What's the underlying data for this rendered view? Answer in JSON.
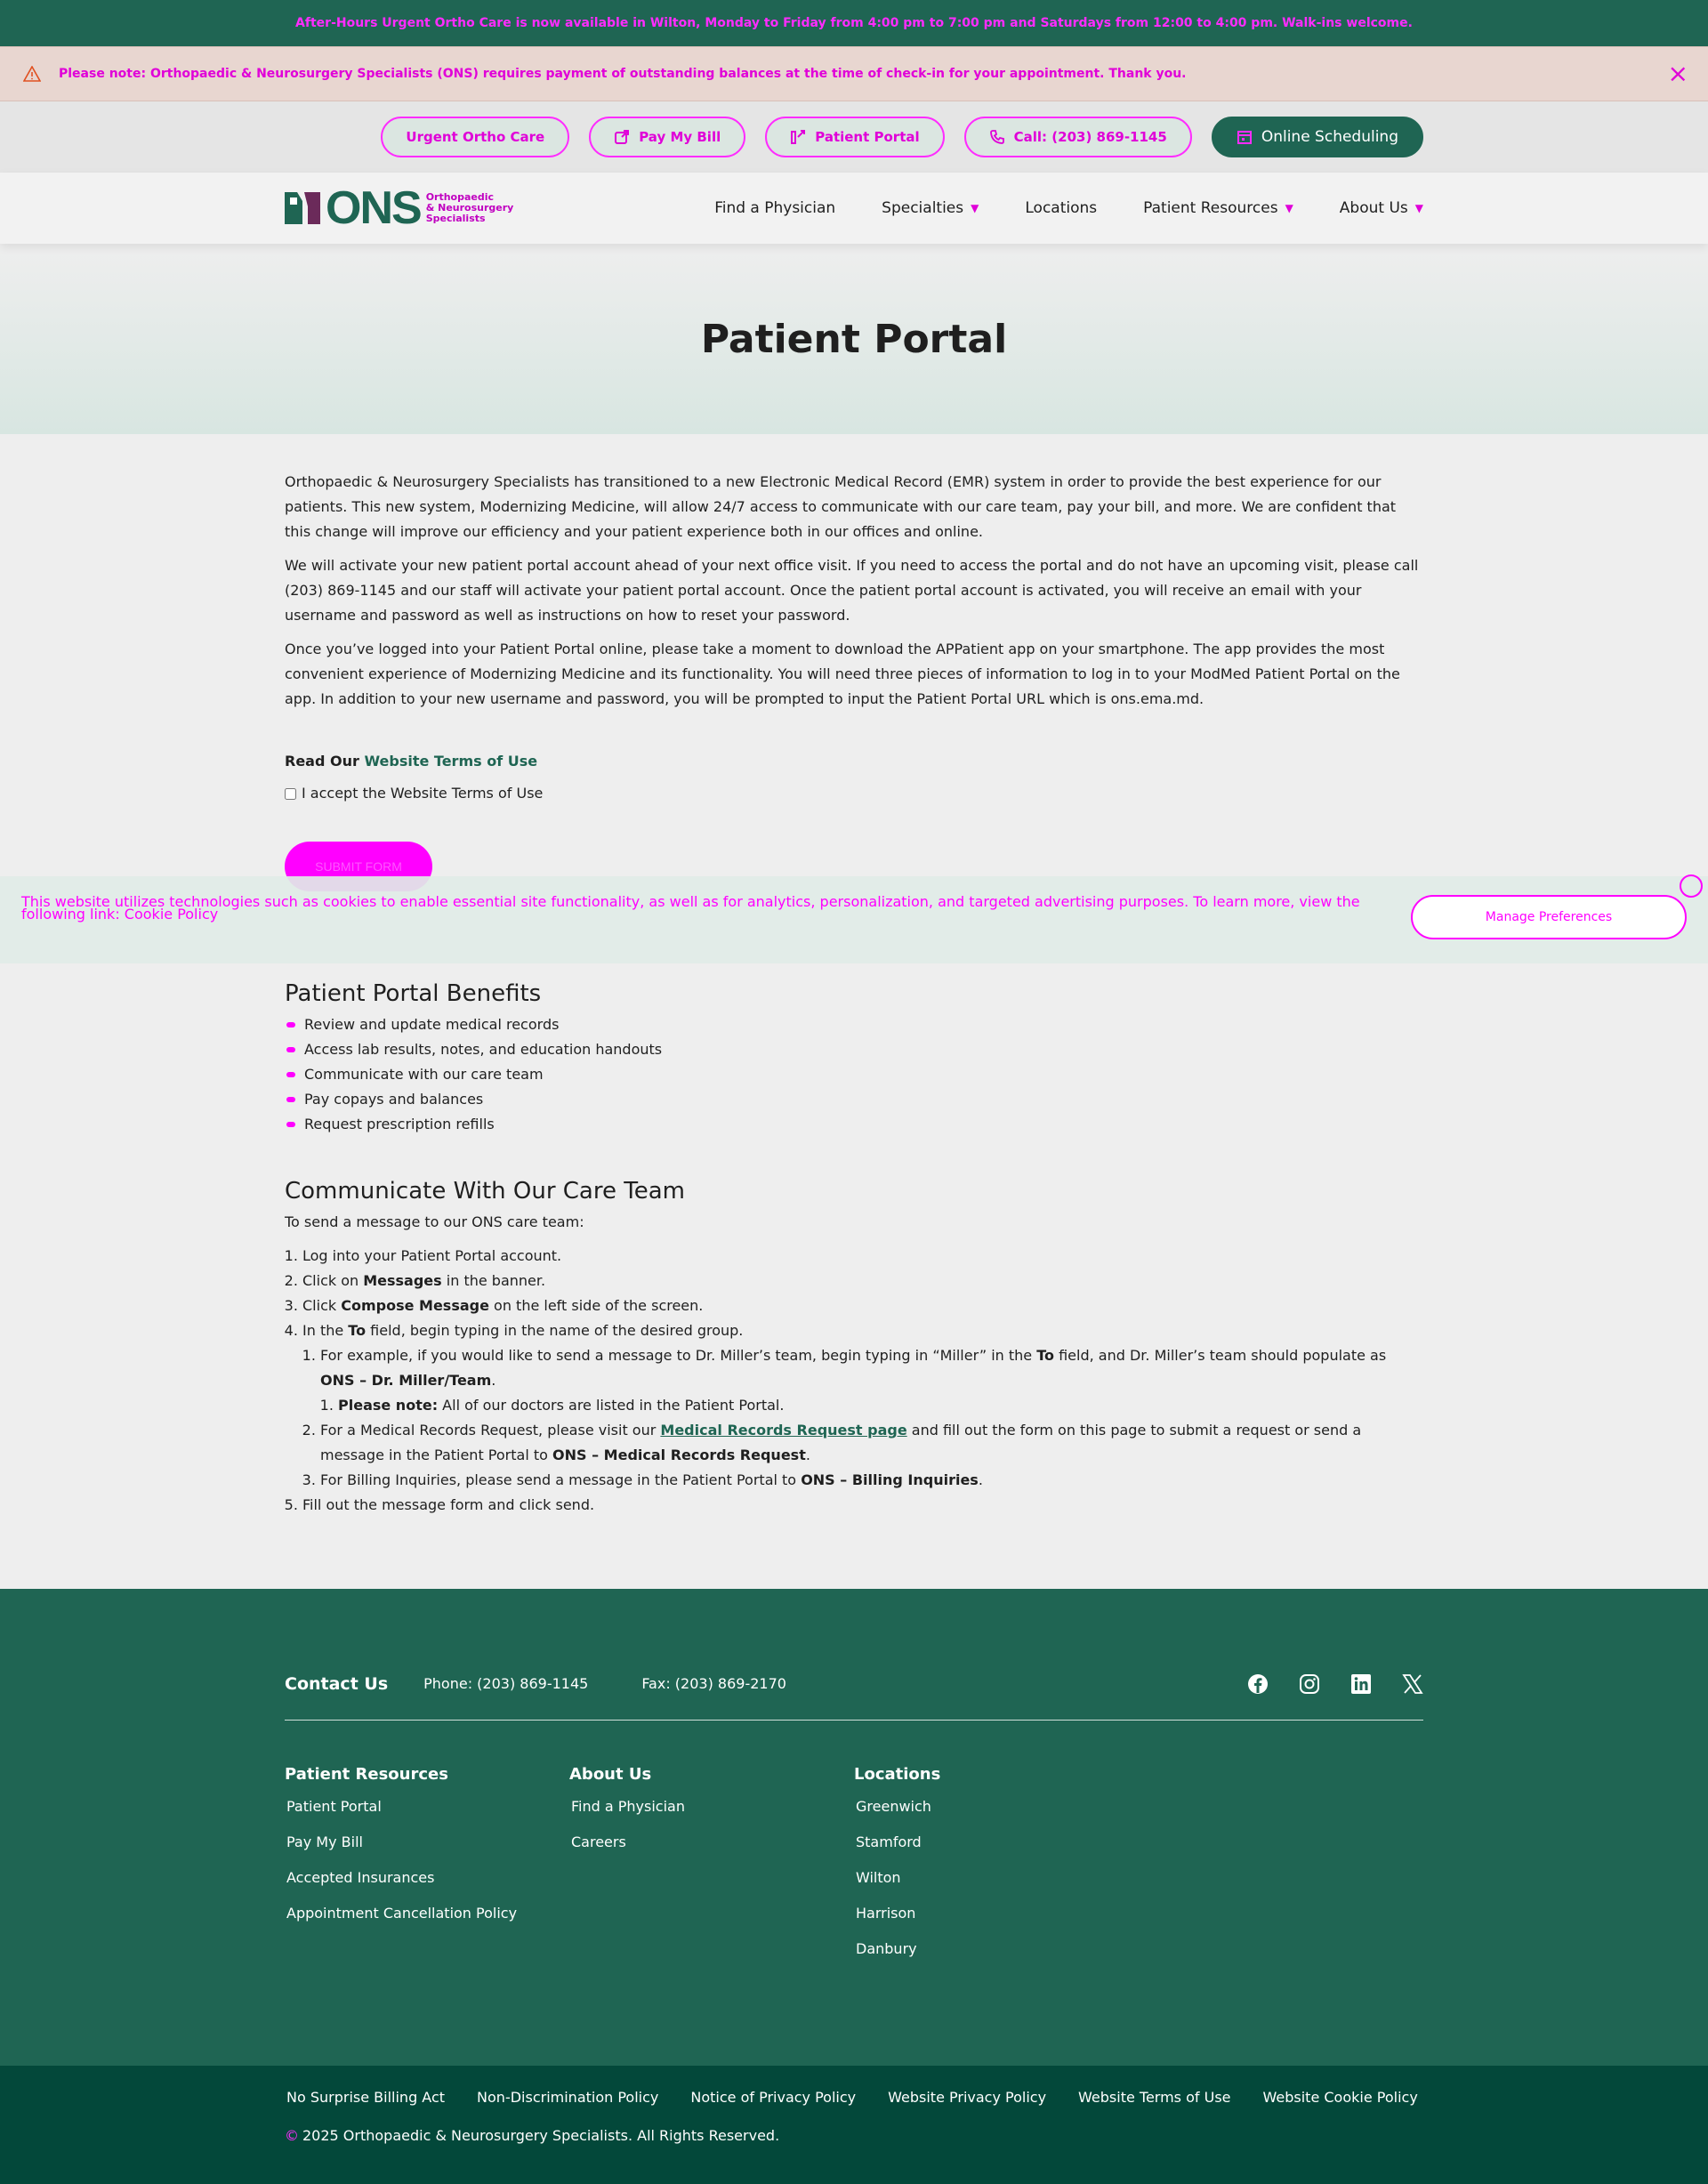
{
  "topbar": {
    "text": "After-Hours Urgent Ortho Care is now available in Wilton, Monday to Friday from 4:00 pm to 7:00 pm and Saturdays from 12:00 to 4:00 pm. Walk-ins welcome."
  },
  "alert": {
    "text": "Please note: Orthopaedic & Neurosurgery Specialists (ONS) requires payment of outstanding balances at the time of check-in for your appointment. Thank you.",
    "close": "×"
  },
  "utility": {
    "urgent": "Urgent Ortho Care",
    "pay": "Pay My Bill",
    "portal": "Patient Portal",
    "call": "Call: (203) 869-1145",
    "schedule": "Online Scheduling"
  },
  "nav": {
    "logo_text": "ONS",
    "logo_sub1": "Orthopaedic",
    "logo_sub2": "& Neurosurgery",
    "logo_sub3": "Specialists",
    "items": [
      "Find a Physician",
      "Specialties",
      "Locations",
      "Patient Resources",
      "About Us"
    ]
  },
  "hero": {
    "title": "Patient Portal"
  },
  "content": {
    "p1": "Orthopaedic & Neurosurgery Specialists has transitioned to a new Electronic Medical Record (EMR) system in order to provide the best experience for our patients. This new system, Modernizing Medicine, will allow 24/7 access to communicate with our care team, pay your bill, and more. We are confident that this change will improve our efficiency and your patient experience both in our offices and online.",
    "p2": "We will activate your new patient portal account ahead of your next office visit. If you need to access the portal and do not have an upcoming visit, please call (203) 869-1145 and our staff will activate your patient portal account. Once the patient portal account is activated, you will receive an email with your username and password as well as instructions on how to reset your password.",
    "p3": "Once you’ve logged into your Patient Portal online, please take a moment to download the APPatient app on your smartphone. The app provides the most convenient experience of Modernizing Medicine and its functionality. You will need three pieces of information to log in to your ModMed Patient Portal on the app. In addition to your new username and password, you will be prompted to input the Patient Portal URL which is ons.ema.md.",
    "terms_prefix": "Read Our ",
    "terms_link": "Website Terms of Use",
    "accept": "I accept the Website Terms of Use",
    "submit": "SUBMIT FORM"
  },
  "cookie": {
    "text": "This website utilizes technologies such as cookies to enable essential site functionality, as well as for analytics, personalization, and targeted advertising purposes. To learn more, view the following link: ",
    "link": "Cookie Policy",
    "manage": "Manage Preferences"
  },
  "benefits": {
    "title": "Patient Portal Benefits",
    "items": [
      "Review and update medical records",
      "Access lab results, notes, and education handouts",
      "Communicate with our care team",
      "Pay copays and balances",
      "Request prescription refills"
    ]
  },
  "communicate": {
    "title": "Communicate With Our Care Team",
    "intro": "To send a message to our ONS care team:",
    "s1": "Log into your Patient Portal account.",
    "s2a": "Click on ",
    "s2b": "Messages",
    "s2c": " in the banner.",
    "s3a": "Click ",
    "s3b": "Compose Message",
    "s3c": " on the left side of the screen.",
    "s4a": "In the ",
    "s4b": "To",
    "s4c": " field, begin typing in the name of the desired group.",
    "s4_1a": "For example, if you would like to send a message to Dr. Miller’s team, begin typing in “Miller” in the ",
    "s4_1b": "To",
    "s4_1c": " field, and Dr. Miller’s team should populate as ",
    "s4_1d": "ONS – Dr. Miller/Team",
    "s4_1e": ".",
    "s4_1_1a": "Please note:",
    "s4_1_1b": " All of our doctors are listed in the Patient Portal.",
    "s4_2a": "For a Medical Records Request, please visit our ",
    "s4_2b": "Medical Records Request page",
    "s4_2c": " and fill out the form on this page to submit a request or send a message in the Patient Portal to ",
    "s4_2d": "ONS – Medical Records Request",
    "s4_2e": ".",
    "s4_3a": "For Billing Inquiries, please send a message in the Patient Portal to ",
    "s4_3b": "ONS – Billing Inquiries",
    "s4_3c": ".",
    "s5": "Fill out the message form and click send."
  },
  "footer": {
    "contact_label": "Contact Us",
    "phone": "Phone: (203) 869-1145",
    "fax": "Fax: (203) 869-2170",
    "col1": {
      "title": "Patient Resources",
      "links": [
        "Patient Portal",
        "Pay My Bill",
        "Accepted Insurances",
        "Appointment Cancellation Policy"
      ]
    },
    "col2": {
      "title": "About Us",
      "links": [
        "Find a Physician",
        "Careers"
      ]
    },
    "col3": {
      "title": "Locations",
      "links": [
        "Greenwich",
        "Stamford",
        "Wilton",
        "Harrison",
        "Danbury"
      ]
    }
  },
  "bottom": {
    "links": [
      "No Surprise Billing Act",
      "Non-Discrimination Policy",
      "Notice of Privacy Policy",
      "Website Privacy Policy",
      "Website Terms of Use",
      "Website Cookie Policy"
    ],
    "copy_symbol": "©",
    "copy": "2025 Orthopaedic & Neurosurgery Specialists. All Rights Reserved."
  },
  "colors": {
    "brand": "#1f6553",
    "brand_dark": "#03483a",
    "accent": "#ff00ff"
  }
}
